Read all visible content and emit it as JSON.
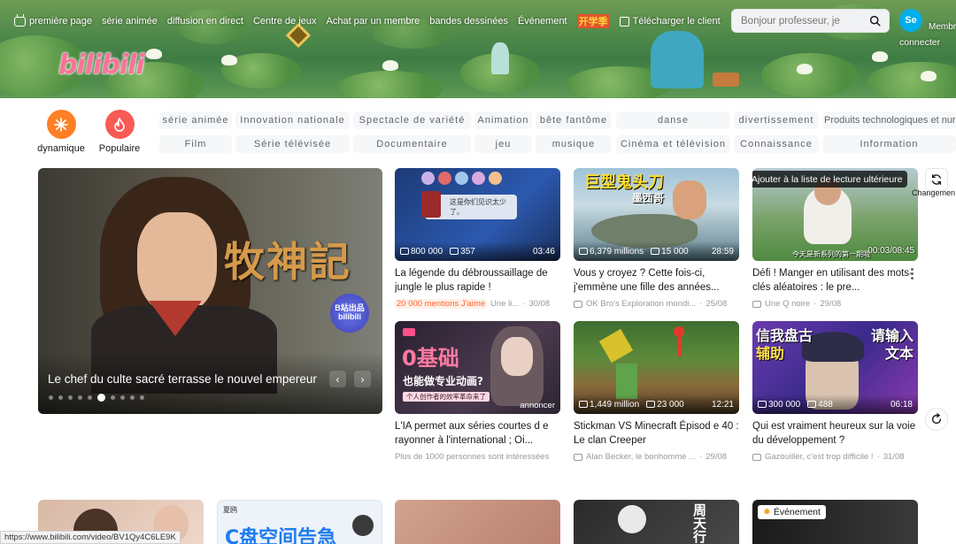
{
  "nav": {
    "items": [
      {
        "label": "première page",
        "icon": "tv-icon"
      },
      {
        "label": "série animée"
      },
      {
        "label": "diffusion en direct"
      },
      {
        "label": "Centre de jeux"
      },
      {
        "label": "Achat par un membre"
      },
      {
        "label": "bandes dessinées"
      },
      {
        "label": "Événement"
      }
    ],
    "hot_label": "开学季",
    "download_label": "Télécharger le client",
    "brand_logo": "bilibili"
  },
  "search": {
    "placeholder": "Bonjour professeur, je"
  },
  "account": {
    "avatar_text": "Se",
    "member_label": "Membr",
    "login_label": "connecter"
  },
  "quick": [
    {
      "label": "dynamique",
      "color": "#ff7f24"
    },
    {
      "label": "Populaire",
      "color": "#f85a54"
    }
  ],
  "channels_row1": [
    "série animée",
    "Innovation nationale",
    "Spectacle de variété",
    "Animation",
    "bête fantôme",
    "danse",
    "divertissement",
    "Produits technologiques et nur"
  ],
  "channels_row2": [
    "Film",
    "Série télévisée",
    "Documentaire",
    "jeu",
    "musique",
    "Cinéma et télévision",
    "Connaissance",
    "Information"
  ],
  "hero": {
    "caption": "Le chef du culte sacré terrasse le nouvel empereur",
    "title_art": "牧神記",
    "badge": "B站出品 bilibili",
    "prev": "‹",
    "next": "›",
    "slides": 10,
    "active_slide": 5
  },
  "cards": [
    {
      "title": "La légende du débroussaillage de jungle le plus rapide !",
      "views": "800 000",
      "comments": "357",
      "duration": "03:46",
      "tag": "20 000 mentions J'aime",
      "author": "Une li...",
      "date": "30/08",
      "overlay_cn": "这是你们见识太少了。"
    },
    {
      "title": "Vous y croyez ? Cette fois-ci, j'emmène une fille des années...",
      "views": "6,379 millions",
      "comments": "15 000",
      "duration": "28:59",
      "author": "OK Bro's Exploration mondi...",
      "date": "25/08",
      "overlay_cn": "巨型鬼头刀",
      "overlay_cn2": "墨西哥"
    },
    {
      "title": "Défi ! Manger en utilisant des mots-clés aléatoires : le pre...",
      "duration": "00:03/08:45",
      "hover_label": "Ajouter à la liste de lecture ultérieure",
      "author": "Une Q noire",
      "date": "29/08",
      "overlay_cn": "今天是新系列的第一期哦"
    },
    {
      "title": "L'IA permet aux séries courtes d e rayonner à l'international ; Oi...",
      "ad_label": "annoncer",
      "author": "Plus de 1000 personnes sont intéressées",
      "overlay_cn": "0基础",
      "overlay_cn2": "也能做专业动画?",
      "overlay_cn3": "个人创作者的效率革命来了"
    },
    {
      "title": "Stickman VS Minecraft Épisod e 40 : Le clan Creeper",
      "views": "1,449 million",
      "comments": "23 000",
      "duration": "12:21",
      "author": "Alan Becker, le bonhomme ...",
      "date": "29/08"
    },
    {
      "title": "Qui est vraiment heureux sur la voie du développement ?",
      "views": "300 000",
      "comments": "488",
      "duration": "06:18",
      "author": "Gazouiller, c'est trop difficile !",
      "date": "31/08",
      "overlay_cn": "信我盘古",
      "overlay_cn2": "辅助",
      "overlay_cn3": "请输入",
      "overlay_cn4": "文本"
    }
  ],
  "bottom": {
    "event_label": "Événement",
    "card2_text": "C盘空间告急",
    "card2_user": "夏鸥",
    "card4_text": "周天行"
  },
  "refresh_label": "Changemen",
  "status_url": "https://www.bilibili.com/video/BV1Qy4C6LE9K"
}
